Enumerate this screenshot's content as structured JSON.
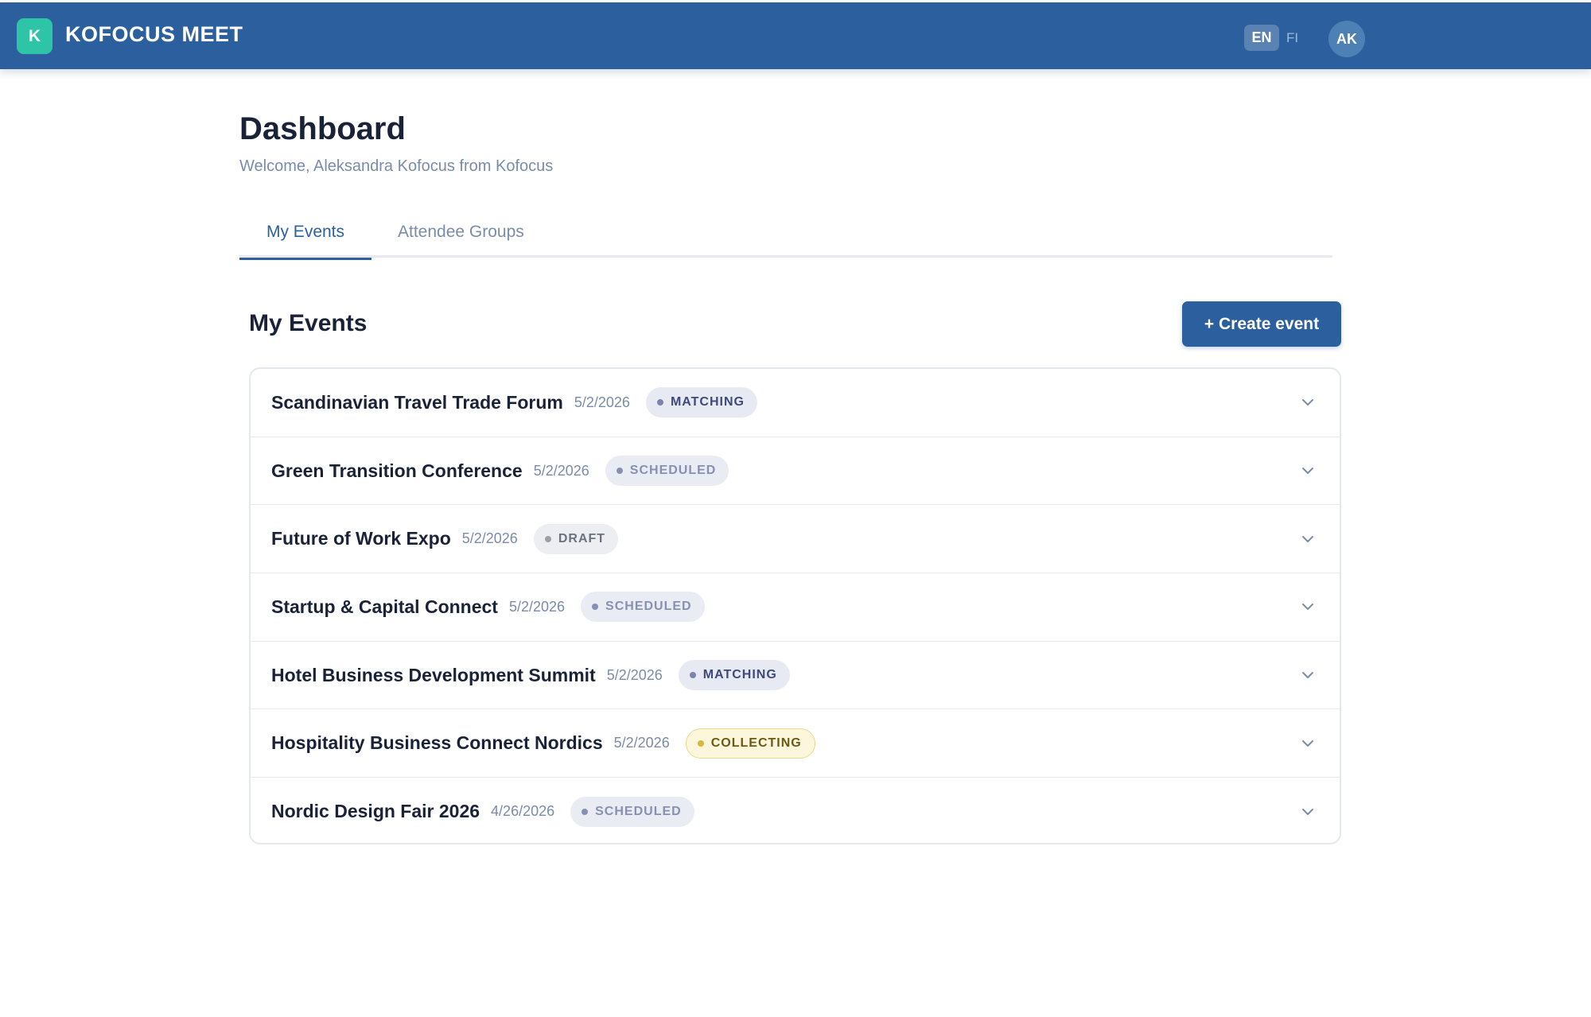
{
  "header": {
    "logo_letter": "K",
    "app_title": "KOFOCUS MEET",
    "lang_en": "EN",
    "lang_fi": "FI",
    "avatar_initials": "AK",
    "brand_color": "#2c5f9e",
    "logo_color": "#2ec4a8"
  },
  "page": {
    "title": "Dashboard",
    "welcome": "Welcome, Aleksandra Kofocus from Kofocus"
  },
  "tabs": [
    {
      "label": "My Events",
      "active": true
    },
    {
      "label": "Attendee Groups",
      "active": false
    }
  ],
  "events_section": {
    "title": "My Events",
    "create_label": "+ Create event",
    "events": [
      {
        "name": "Scandinavian Travel Trade Forum",
        "date": "5/2/2026",
        "status": "MATCHING"
      },
      {
        "name": "Green Transition Conference",
        "date": "5/2/2026",
        "status": "SCHEDULED"
      },
      {
        "name": "Future of Work Expo",
        "date": "5/2/2026",
        "status": "DRAFT"
      },
      {
        "name": "Startup & Capital Connect",
        "date": "5/2/2026",
        "status": "SCHEDULED"
      },
      {
        "name": "Hotel Business Development Summit",
        "date": "5/2/2026",
        "status": "MATCHING"
      },
      {
        "name": "Hospitality Business Connect Nordics",
        "date": "5/2/2026",
        "status": "COLLECTING"
      },
      {
        "name": "Nordic Design Fair 2026",
        "date": "4/26/2026",
        "status": "SCHEDULED"
      }
    ]
  }
}
